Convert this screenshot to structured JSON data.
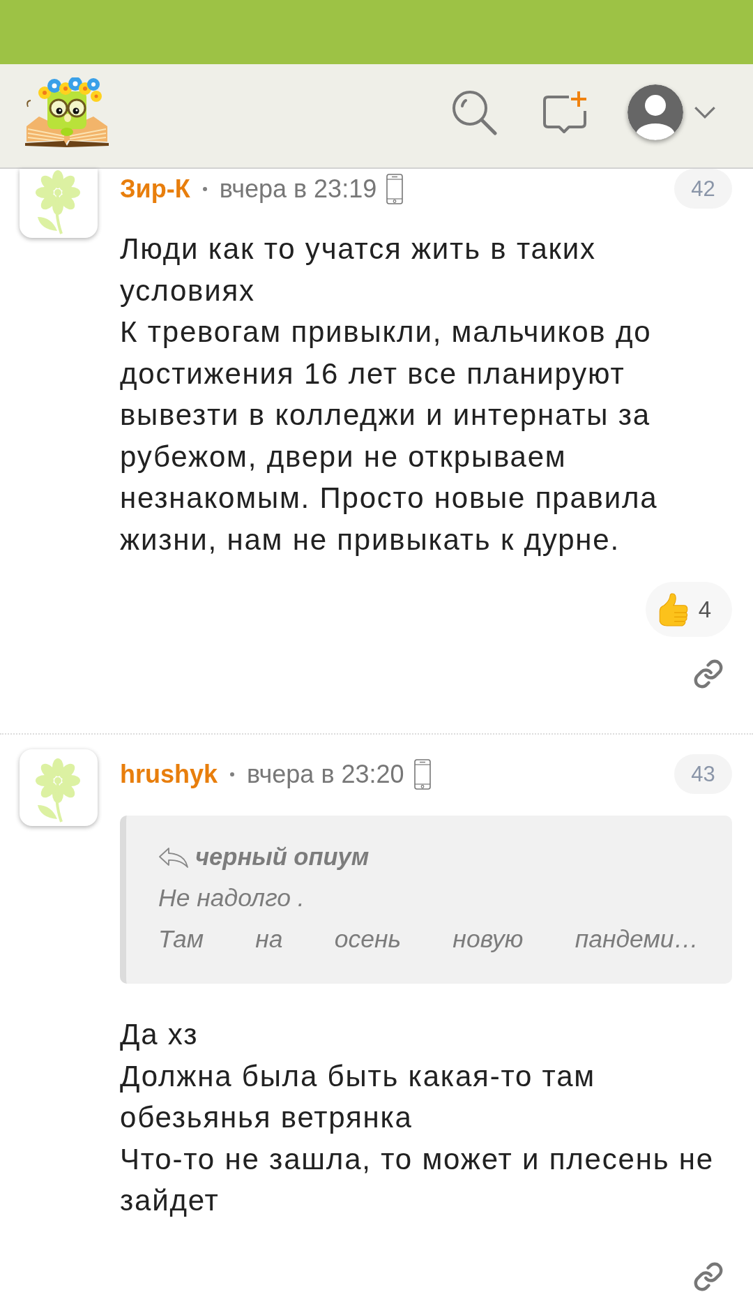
{
  "comments": [
    {
      "author": "Зир-К",
      "time": "вчера в 23:19",
      "number": "42",
      "paragraphs": [
        "Люди как то учатся жить в таких условиях",
        "К тревогам привыкли, мальчиков до достижения 16 лет все планируют вывезти в колледжи и интернаты за рубежом, двери не открываем незнакомым. Просто новые правила жизни, нам не привыкать к дурне."
      ],
      "reactions": [
        {
          "count": "4"
        }
      ]
    },
    {
      "author": "hrushyk",
      "time": "вчера в 23:20",
      "number": "43",
      "quote": {
        "author": "черный опиум",
        "lines": [
          "Не надолго .",
          "Там на осень новую пандеми…"
        ]
      },
      "paragraphs": [
        "Да хз",
        "Должна была быть какая-то там обезьянья ветрянка",
        "Что-то не зашла, то может и плесень не зайдет"
      ]
    }
  ]
}
